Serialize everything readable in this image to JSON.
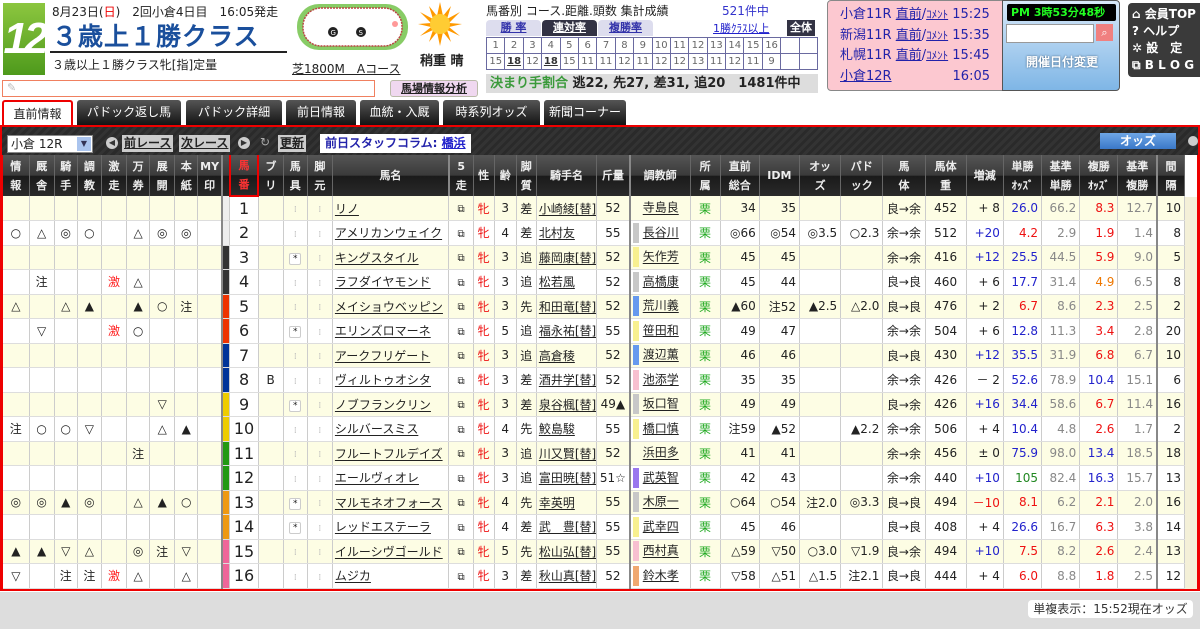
{
  "header": {
    "race_number": "12",
    "date_prefix": "8月23日(",
    "date_day": "日",
    "date_suffix": ")　2回小倉4日目　16:05発走",
    "title": "３歳上１勝クラス",
    "subtitle": "３歳以上１勝クラス牝[指]定量",
    "course": "芝1800M　Aコース",
    "weather": "稍重 晴",
    "memo_placeholder": "✎",
    "baba_button": "馬場情報分析"
  },
  "stats": {
    "title": "馬番別 コース.距離.頭数 集計成績",
    "count": "521件中",
    "tabs": [
      "勝 率",
      "連対率",
      "複勝率"
    ],
    "active_tab": "連対率",
    "class_link": "1勝ｸﾗｽ以上",
    "all_button": "全体",
    "numbers": [
      "1",
      "2",
      "3",
      "4",
      "5",
      "6",
      "7",
      "8",
      "9",
      "10",
      "11",
      "12",
      "13",
      "14",
      "15",
      "16",
      "",
      ""
    ],
    "values": [
      "15",
      "18",
      "12",
      "18",
      "15",
      "11",
      "11",
      "12",
      "11",
      "12",
      "12",
      "13",
      "11",
      "12",
      "11",
      "9",
      "",
      ""
    ],
    "bold_values": [
      "2",
      "4"
    ],
    "kimarite_label": "決まり手割合",
    "kimarite_values": "逃22, 先27, 差31, 追20　1481件中"
  },
  "next_races": [
    {
      "race": "小倉11R",
      "link1": "直前",
      "link2": "ｺﾒﾝﾄ",
      "time": "15:25"
    },
    {
      "race": "新潟11R",
      "link1": "直前",
      "link2": "ｺﾒﾝﾄ",
      "time": "15:35"
    },
    {
      "race": "札幌11R",
      "link1": "直前",
      "link2": "ｺﾒﾝﾄ",
      "time": "15:45"
    },
    {
      "race": "小倉12R",
      "link1": "",
      "link2": "",
      "time": "16:05"
    }
  ],
  "clock": "PM 3時53分48秒",
  "search_icon": "magnifier-icon",
  "date_change": "開催日付変更",
  "menu": [
    "⌂ 会員TOP",
    "? ヘルプ",
    "✲ 設　定",
    "⧉ B L O G"
  ],
  "tabs": [
    "直前情報",
    "パドック返し馬",
    "パドック詳細",
    "前日情報",
    "血統・入厩",
    "時系列オッズ",
    "新聞コーナー"
  ],
  "toolbar": {
    "race_select": "小倉 12R",
    "prev": "前レース",
    "next": "次レース",
    "refresh": "更新",
    "column_label": "前日スタッフコラム: ",
    "column_link": "橋浜",
    "odds_button": "オッズ"
  },
  "columns": [
    "情\n報",
    "厩\n舎",
    "騎\n手",
    "調\n教",
    "激\n走",
    "万\n券",
    "展\n開",
    "本\n紙",
    "MY\n印",
    "",
    "馬\n番",
    "ブ\nリ",
    "馬\n具",
    "脚\n元",
    "馬名",
    "5\n走",
    "性",
    "齢",
    "脚\n質",
    "騎手名",
    "斤量",
    "調教師",
    "所\n属",
    "直前\n総合",
    "IDM",
    "オッ\nズ",
    "パド\nック",
    "馬\n体",
    "馬体\n重",
    "増減",
    "単勝\nｵｯｽﾞ",
    "基準\n単勝",
    "複勝\nｵｯｽﾞ",
    "基準\n複勝",
    "間\n隔"
  ],
  "waku_colors": [
    "#eeeeee",
    "#333333",
    "#ee3300",
    "#003399",
    "#eecc00",
    "#229911",
    "#ee9911",
    "#ee6699"
  ],
  "horses": [
    {
      "marks": [
        "",
        "",
        "",
        "",
        "",
        "",
        "",
        "",
        ""
      ],
      "no": "1",
      "waku": 1,
      "bl": "",
      "gear": false,
      "name": "リノ",
      "sex": "牝",
      "age": "3",
      "style": "差",
      "jockey": "小崎綾[替]",
      "kin": "52",
      "trainer": "寺島良",
      "tc": "",
      "aff": "栗",
      "sogo": "34",
      "idm": "35",
      "odds_mark": "",
      "pad": "",
      "body": "良→余",
      "wt": "452",
      "diff": "+ 8",
      "dc": "",
      "tan": "26.0",
      "tc1": "blue",
      "ktan": "66.2",
      "fuku": "8.3",
      "fc": "red",
      "kfuku": "12.7",
      "int": "10"
    },
    {
      "marks": [
        "○",
        "△",
        "◎",
        "○",
        "",
        "△",
        "◎",
        "◎",
        ""
      ],
      "no": "2",
      "waku": 1,
      "bl": "",
      "gear": false,
      "name": "アメリカンウェイク",
      "sex": "牝",
      "age": "4",
      "style": "差",
      "jockey": "北村友",
      "kin": "55",
      "trainer": "長谷川",
      "tc": "#c8c8c8",
      "aff": "栗",
      "sogo": "◎66",
      "idm": "◎54",
      "odds_mark": "◎3.5",
      "pad": "○2.3",
      "body": "余→余",
      "wt": "512",
      "diff": "+20",
      "dc": "blue",
      "tan": "4.2",
      "tc1": "red",
      "ktan": "2.9",
      "fuku": "1.9",
      "fc": "red",
      "kfuku": "1.4",
      "int": "8"
    },
    {
      "marks": [
        "",
        "",
        "",
        "",
        "",
        "",
        "",
        "",
        ""
      ],
      "no": "3",
      "waku": 2,
      "bl": "",
      "gear": true,
      "name": "キングスタイル",
      "sex": "牝",
      "age": "3",
      "style": "追",
      "jockey": "藤岡康[替]",
      "kin": "52",
      "trainer": "矢作芳",
      "tc": "#f8f090",
      "aff": "栗",
      "sogo": "45",
      "idm": "45",
      "odds_mark": "",
      "pad": "",
      "body": "余→余",
      "wt": "416",
      "diff": "+12",
      "dc": "blue",
      "tan": "25.5",
      "tc1": "blue",
      "ktan": "44.5",
      "fuku": "5.9",
      "fc": "red",
      "kfuku": "9.0",
      "int": "5"
    },
    {
      "marks": [
        "",
        "注",
        "",
        "",
        "激",
        "△",
        "",
        "",
        ""
      ],
      "no": "4",
      "waku": 2,
      "bl": "",
      "gear": false,
      "name": "ラフダイヤモンド",
      "sex": "牝",
      "age": "3",
      "style": "追",
      "jockey": "松若風",
      "kin": "52",
      "trainer": "高橋康",
      "tc": "#c8c8c8",
      "aff": "栗",
      "sogo": "45",
      "idm": "44",
      "odds_mark": "",
      "pad": "",
      "body": "良→良",
      "wt": "460",
      "diff": "+ 6",
      "dc": "",
      "tan": "17.7",
      "tc1": "blue",
      "ktan": "31.4",
      "fuku": "4.9",
      "fc": "orange",
      "kfuku": "6.5",
      "int": "8"
    },
    {
      "marks": [
        "△",
        "",
        "△",
        "▲",
        "",
        "▲",
        "○",
        "注",
        ""
      ],
      "no": "5",
      "waku": 3,
      "bl": "",
      "gear": false,
      "name": "メイショウベッピン",
      "sex": "牝",
      "age": "3",
      "style": "先",
      "jockey": "和田竜[替]",
      "kin": "52",
      "trainer": "荒川義",
      "tc": "#6699ee",
      "aff": "栗",
      "sogo": "▲60",
      "idm": "注52",
      "odds_mark": "▲2.5",
      "pad": "△2.0",
      "body": "良→良",
      "wt": "476",
      "diff": "+ 2",
      "dc": "",
      "tan": "6.7",
      "tc1": "red",
      "ktan": "8.6",
      "fuku": "2.3",
      "fc": "red",
      "kfuku": "2.5",
      "int": "2"
    },
    {
      "marks": [
        "",
        "▽",
        "",
        "",
        "激",
        "○",
        "",
        "",
        ""
      ],
      "no": "6",
      "waku": 3,
      "bl": "",
      "gear": true,
      "name": "エリンズロマーネ",
      "sex": "牝",
      "age": "5",
      "style": "追",
      "jockey": "福永祐[替]",
      "kin": "55",
      "trainer": "笹田和",
      "tc": "#f8f090",
      "aff": "栗",
      "sogo": "49",
      "idm": "47",
      "odds_mark": "",
      "pad": "",
      "body": "余→余",
      "wt": "504",
      "diff": "+ 6",
      "dc": "",
      "tan": "12.8",
      "tc1": "blue",
      "ktan": "11.3",
      "fuku": "3.4",
      "fc": "red",
      "kfuku": "2.8",
      "int": "20"
    },
    {
      "marks": [
        "",
        "",
        "",
        "",
        "",
        "",
        "",
        "",
        ""
      ],
      "no": "7",
      "waku": 4,
      "bl": "",
      "gear": false,
      "name": "アークフリゲート",
      "sex": "牝",
      "age": "3",
      "style": "追",
      "jockey": "高倉稜",
      "kin": "52",
      "trainer": "渡辺薫",
      "tc": "#6699ee",
      "aff": "栗",
      "sogo": "46",
      "idm": "46",
      "odds_mark": "",
      "pad": "",
      "body": "良→良",
      "wt": "430",
      "diff": "+12",
      "dc": "blue",
      "tan": "35.5",
      "tc1": "blue",
      "ktan": "31.9",
      "fuku": "6.8",
      "fc": "red",
      "kfuku": "6.7",
      "int": "10"
    },
    {
      "marks": [
        "",
        "",
        "",
        "",
        "",
        "",
        "",
        "",
        ""
      ],
      "no": "8",
      "waku": 4,
      "bl": "B",
      "gear": false,
      "name": "ヴィルトゥオシタ",
      "sex": "牝",
      "age": "3",
      "style": "差",
      "jockey": "酒井学[替]",
      "kin": "52",
      "trainer": "池添学",
      "tc": "#f8c0d0",
      "aff": "栗",
      "sogo": "35",
      "idm": "35",
      "odds_mark": "",
      "pad": "",
      "body": "余→余",
      "wt": "426",
      "diff": "－ 2",
      "dc": "",
      "tan": "52.6",
      "tc1": "blue",
      "ktan": "78.9",
      "fuku": "10.4",
      "fc": "blue",
      "kfuku": "15.1",
      "int": "6"
    },
    {
      "marks": [
        "",
        "",
        "",
        "",
        "",
        "",
        "▽",
        "",
        ""
      ],
      "no": "9",
      "waku": 5,
      "bl": "",
      "gear": true,
      "name": "ノブフランクリン",
      "sex": "牝",
      "age": "3",
      "style": "差",
      "jockey": "泉谷楓[替]",
      "kin": "49▲",
      "trainer": "坂口智",
      "tc": "#c8c8c8",
      "aff": "栗",
      "sogo": "49",
      "idm": "49",
      "odds_mark": "",
      "pad": "",
      "body": "良→余",
      "wt": "426",
      "diff": "+16",
      "dc": "blue",
      "tan": "34.4",
      "tc1": "blue",
      "ktan": "58.6",
      "fuku": "6.7",
      "fc": "red",
      "kfuku": "11.4",
      "int": "16"
    },
    {
      "marks": [
        "注",
        "○",
        "○",
        "▽",
        "",
        "",
        "△",
        "▲",
        ""
      ],
      "no": "10",
      "waku": 5,
      "bl": "",
      "gear": false,
      "name": "シルバースミス",
      "sex": "牝",
      "age": "4",
      "style": "先",
      "jockey": "鮫島駿",
      "kin": "55",
      "trainer": "橋口慎",
      "tc": "#f8f090",
      "aff": "栗",
      "sogo": "注59",
      "idm": "▲52",
      "odds_mark": "",
      "pad": "▲2.2",
      "body": "余→余",
      "wt": "506",
      "diff": "+ 4",
      "dc": "",
      "tan": "10.4",
      "tc1": "blue",
      "ktan": "4.8",
      "fuku": "2.6",
      "fc": "red",
      "kfuku": "1.7",
      "int": "2"
    },
    {
      "marks": [
        "",
        "",
        "",
        "",
        "",
        "注",
        "",
        "",
        ""
      ],
      "no": "11",
      "waku": 6,
      "bl": "",
      "gear": false,
      "name": "フルートフルデイズ",
      "sex": "牝",
      "age": "3",
      "style": "追",
      "jockey": "川又賢[替]",
      "kin": "52",
      "trainer": "浜田多",
      "tc": "",
      "aff": "栗",
      "sogo": "41",
      "idm": "41",
      "odds_mark": "",
      "pad": "",
      "body": "余→余",
      "wt": "456",
      "diff": "± 0",
      "dc": "",
      "tan": "75.9",
      "tc1": "blue",
      "ktan": "98.0",
      "fuku": "13.4",
      "fc": "blue",
      "kfuku": "18.5",
      "int": "18"
    },
    {
      "marks": [
        "",
        "",
        "",
        "",
        "",
        "",
        "",
        "",
        ""
      ],
      "no": "12",
      "waku": 6,
      "bl": "",
      "gear": false,
      "name": "エールヴィオレ",
      "sex": "牝",
      "age": "3",
      "style": "追",
      "jockey": "富田暁[替]",
      "kin": "51☆",
      "trainer": "武英智",
      "tc": "#9977ee",
      "aff": "栗",
      "sogo": "42",
      "idm": "43",
      "odds_mark": "",
      "pad": "",
      "body": "余→余",
      "wt": "440",
      "diff": "+10",
      "dc": "blue",
      "tan": "105",
      "tc1": "green",
      "ktan": "82.4",
      "fuku": "16.3",
      "fc": "blue",
      "kfuku": "15.7",
      "int": "13"
    },
    {
      "marks": [
        "◎",
        "◎",
        "▲",
        "◎",
        "",
        "△",
        "▲",
        "○",
        ""
      ],
      "no": "13",
      "waku": 7,
      "bl": "",
      "gear": true,
      "name": "マルモネオフォース",
      "sex": "牝",
      "age": "4",
      "style": "先",
      "jockey": "幸英明",
      "kin": "55",
      "trainer": "木原一",
      "tc": "#c8c8c8",
      "aff": "栗",
      "sogo": "○64",
      "idm": "○54",
      "odds_mark": "注2.0",
      "pad": "◎3.3",
      "body": "良→良",
      "wt": "494",
      "diff": "－10",
      "dc": "red",
      "tan": "8.1",
      "tc1": "red",
      "ktan": "6.2",
      "fuku": "2.1",
      "fc": "red",
      "kfuku": "2.0",
      "int": "16"
    },
    {
      "marks": [
        "",
        "",
        "",
        "",
        "",
        "",
        "",
        "",
        ""
      ],
      "no": "14",
      "waku": 7,
      "bl": "",
      "gear": true,
      "name": "レッドエステーラ",
      "sex": "牝",
      "age": "4",
      "style": "差",
      "jockey": "武　豊[替]",
      "kin": "55",
      "trainer": "武幸四",
      "tc": "#f8f090",
      "aff": "栗",
      "sogo": "45",
      "idm": "46",
      "odds_mark": "",
      "pad": "",
      "body": "良→良",
      "wt": "408",
      "diff": "+ 4",
      "dc": "",
      "tan": "26.6",
      "tc1": "blue",
      "ktan": "16.7",
      "fuku": "6.3",
      "fc": "red",
      "kfuku": "3.8",
      "int": "14"
    },
    {
      "marks": [
        "▲",
        "▲",
        "▽",
        "△",
        "",
        "◎",
        "注",
        "▽",
        ""
      ],
      "no": "15",
      "waku": 8,
      "bl": "",
      "gear": false,
      "name": "イルーシヴゴールド",
      "sex": "牝",
      "age": "5",
      "style": "先",
      "jockey": "松山弘[替]",
      "kin": "55",
      "trainer": "西村真",
      "tc": "#f8c0d0",
      "aff": "栗",
      "sogo": "△59",
      "idm": "▽50",
      "odds_mark": "○3.0",
      "pad": "▽1.9",
      "body": "良→余",
      "wt": "494",
      "diff": "+10",
      "dc": "blue",
      "tan": "7.5",
      "tc1": "red",
      "ktan": "8.2",
      "fuku": "2.6",
      "fc": "red",
      "kfuku": "2.4",
      "int": "13"
    },
    {
      "marks": [
        "▽",
        "",
        "注",
        "注",
        "激",
        "△",
        "",
        "△",
        ""
      ],
      "no": "16",
      "waku": 8,
      "bl": "",
      "gear": false,
      "name": "ムジカ",
      "sex": "牝",
      "age": "3",
      "style": "差",
      "jockey": "秋山真[替]",
      "kin": "52",
      "trainer": "鈴木孝",
      "tc": "#f0a870",
      "aff": "栗",
      "sogo": "▽58",
      "idm": "△51",
      "odds_mark": "△1.5",
      "pad": "注2.1",
      "body": "良→良",
      "wt": "444",
      "diff": "+ 4",
      "dc": "",
      "tan": "6.0",
      "tc1": "red",
      "ktan": "8.8",
      "fuku": "1.8",
      "fc": "red",
      "kfuku": "2.5",
      "int": "12"
    }
  ],
  "footer": {
    "odds_time": "単複表示：15:52現在オッズ"
  }
}
